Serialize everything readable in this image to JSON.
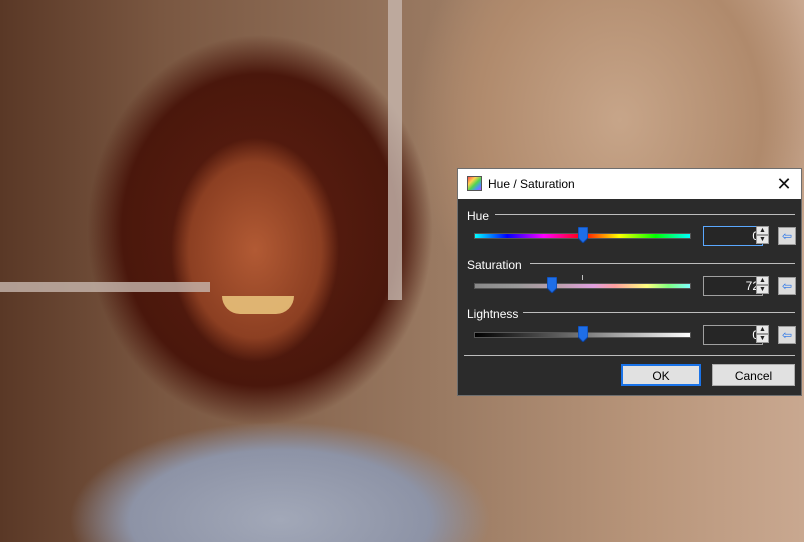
{
  "dialog": {
    "title": "Hue / Saturation",
    "close_glyph": "✕",
    "icon": "hue-saturation-app-icon"
  },
  "sections": {
    "hue": {
      "label": "Hue",
      "value": "0",
      "slider_fraction": 0.5
    },
    "saturation": {
      "label": "Saturation",
      "value": "72",
      "slider_fraction": 0.36
    },
    "lightness": {
      "label": "Lightness",
      "value": "0",
      "slider_fraction": 0.5
    }
  },
  "spinner": {
    "up_glyph": "▲",
    "down_glyph": "▼"
  },
  "reset_glyph": "⇦",
  "buttons": {
    "ok": "OK",
    "cancel": "Cancel"
  },
  "colors": {
    "dialog_bg": "#2b2b2b",
    "accent": "#1a73e8",
    "thumb": "#1e6ee8"
  }
}
